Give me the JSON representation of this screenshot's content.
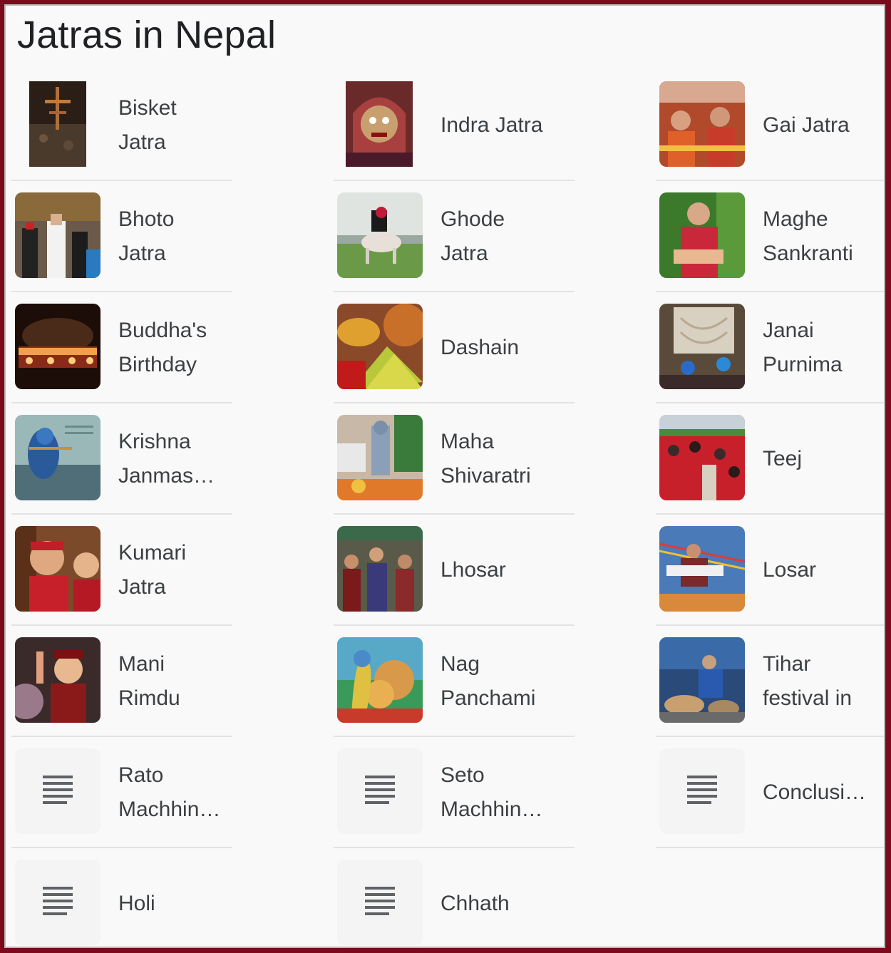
{
  "page": {
    "title": "Jatras in Nepal"
  },
  "columns": [
    [
      {
        "lines": [
          "Bisket",
          "Jatra"
        ],
        "thumb": "photo"
      },
      {
        "lines": [
          "Bhoto",
          "Jatra"
        ],
        "thumb": "photo"
      },
      {
        "lines": [
          "Buddha's",
          "Birthday"
        ],
        "thumb": "photo"
      },
      {
        "lines": [
          "Krishna",
          "Janmas…"
        ],
        "thumb": "photo"
      },
      {
        "lines": [
          "Kumari",
          "Jatra"
        ],
        "thumb": "photo"
      },
      {
        "lines": [
          "Mani",
          "Rimdu"
        ],
        "thumb": "photo"
      },
      {
        "lines": [
          "Rato",
          "Machhin…"
        ],
        "thumb": "document-icon"
      },
      {
        "lines": [
          "Holi"
        ],
        "thumb": "document-icon"
      }
    ],
    [
      {
        "lines": [
          "Indra Jatra"
        ],
        "thumb": "photo"
      },
      {
        "lines": [
          "Ghode",
          "Jatra"
        ],
        "thumb": "photo"
      },
      {
        "lines": [
          "Dashain"
        ],
        "thumb": "photo"
      },
      {
        "lines": [
          "Maha",
          "Shivaratri"
        ],
        "thumb": "photo"
      },
      {
        "lines": [
          "Lhosar"
        ],
        "thumb": "photo"
      },
      {
        "lines": [
          "Nag",
          "Panchami"
        ],
        "thumb": "photo"
      },
      {
        "lines": [
          "Seto",
          "Machhin…"
        ],
        "thumb": "document-icon"
      },
      {
        "lines": [
          "Chhath"
        ],
        "thumb": "document-icon"
      }
    ],
    [
      {
        "lines": [
          "Gai Jatra"
        ],
        "thumb": "photo"
      },
      {
        "lines": [
          "Maghe",
          "Sankranti"
        ],
        "thumb": "photo"
      },
      {
        "lines": [
          "Janai",
          "Purnima"
        ],
        "thumb": "photo"
      },
      {
        "lines": [
          "Teej"
        ],
        "thumb": "photo"
      },
      {
        "lines": [
          "Losar"
        ],
        "thumb": "photo"
      },
      {
        "lines": [
          "Tihar",
          "festival in"
        ],
        "thumb": "photo"
      },
      {
        "lines": [
          "Conclusi…"
        ],
        "thumb": "document-icon"
      }
    ]
  ],
  "colors": {
    "frame": "#7a0a1c",
    "background": "#f9f9f9",
    "text": "#3c4043",
    "divider": "#e3e3e3",
    "doc_icon": "#5f6368"
  }
}
